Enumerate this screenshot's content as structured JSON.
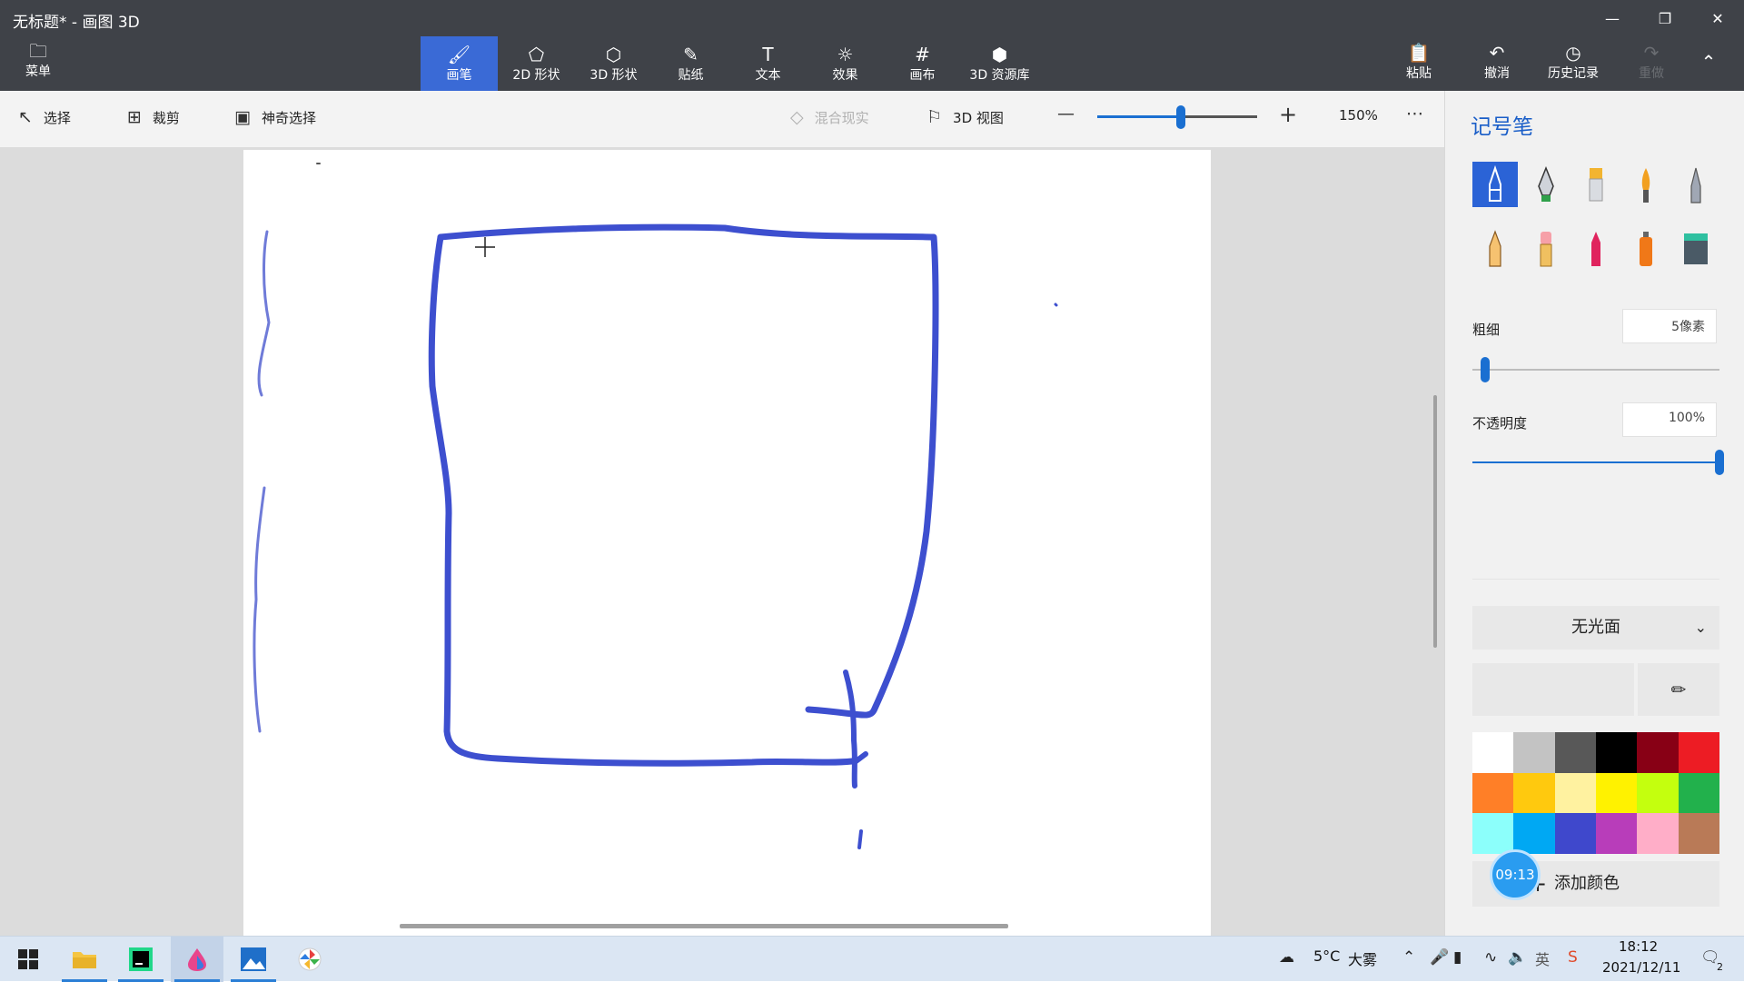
{
  "window": {
    "title": "无标题* - 画图 3D"
  },
  "menu": {
    "label": "菜单"
  },
  "tabs": [
    {
      "label": "画笔",
      "icon": "brush-icon"
    },
    {
      "label": "2D 形状",
      "icon": "shapes-2d-icon"
    },
    {
      "label": "3D 形状",
      "icon": "cube-icon"
    },
    {
      "label": "贴纸",
      "icon": "sticker-icon"
    },
    {
      "label": "文本",
      "icon": "text-icon"
    },
    {
      "label": "效果",
      "icon": "sun-icon"
    },
    {
      "label": "画布",
      "icon": "canvas-icon"
    },
    {
      "label": "3D 资源库",
      "icon": "library-3d-icon"
    }
  ],
  "right_actions": {
    "paste": "粘贴",
    "undo": "撤消",
    "history": "历史记录",
    "redo": "重做"
  },
  "toolbar": {
    "select": "选择",
    "crop": "裁剪",
    "magic_select": "神奇选择",
    "mixed_reality": "混合现实",
    "view_3d": "3D 视图",
    "zoom": "150%",
    "zoom_fraction": 0.52
  },
  "panel": {
    "title": "记号笔",
    "brushes": [
      "marker",
      "calligraphy-pen",
      "oil-brush",
      "watercolor",
      "pixel-pen",
      "pencil",
      "eraser",
      "crayon",
      "spray-can",
      "fill"
    ],
    "thickness_label": "粗细",
    "thickness_value": "5像素",
    "thickness_fraction": 0.05,
    "opacity_label": "不透明度",
    "opacity_value": "100%",
    "opacity_fraction": 1.0,
    "finish": "无光面",
    "add_color": "添加颜色",
    "selected_color": "#3d4fcf",
    "palette": [
      "#ffffff",
      "#c3c3c3",
      "#585858",
      "#000000",
      "#880015",
      "#ed1c24",
      "#ff7f27",
      "#ffc90e",
      "#fff2a0",
      "#fff200",
      "#c4ff0e",
      "#22b14c",
      "#8cfffb",
      "#00a8f3",
      "#3f48cc",
      "#b83dba",
      "#ffaec8",
      "#b97a57"
    ]
  },
  "floating_clock": "09:13",
  "taskbar": {
    "weather_temp": "5°C",
    "weather_desc": "大雾",
    "ime": "英",
    "time": "18:12",
    "date": "2021/12/11",
    "notifications": "2"
  }
}
